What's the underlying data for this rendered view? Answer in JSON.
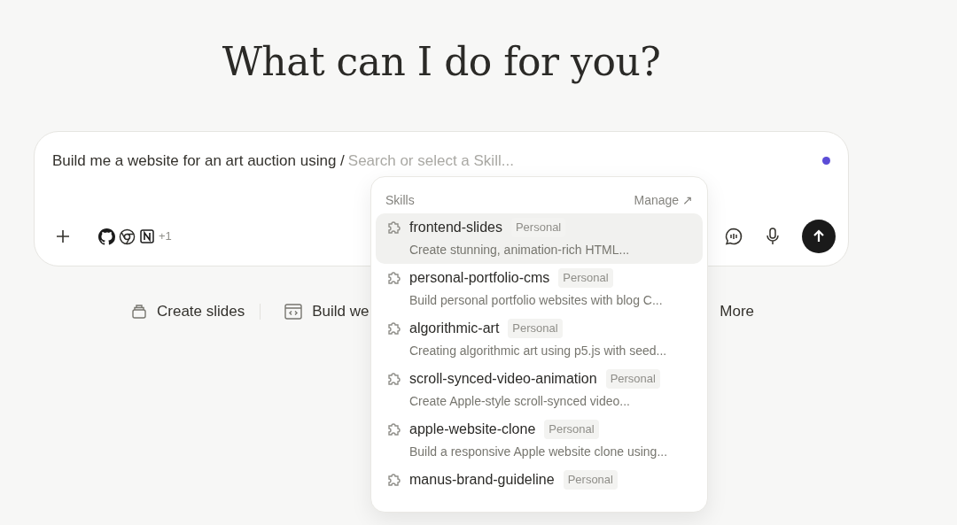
{
  "heading": "What can I do for you?",
  "prompt": {
    "value": "Build me a website for an art auction using /",
    "placeholder": "Search or select a Skill...",
    "connectors_more": "+1"
  },
  "suggestions": [
    {
      "label": "Create slides",
      "kind": "slides"
    },
    {
      "label": "Build we",
      "kind": "web"
    },
    {
      "label": "More",
      "kind": "more"
    }
  ],
  "skills_menu": {
    "title": "Skills",
    "manage": "Manage ↗",
    "items": [
      {
        "name": "frontend-slides",
        "tag": "Personal",
        "description": "Create stunning, animation-rich HTML...",
        "selected": true
      },
      {
        "name": "personal-portfolio-cms",
        "tag": "Personal",
        "description": "Build personal portfolio websites with blog C...",
        "selected": false
      },
      {
        "name": "algorithmic-art",
        "tag": "Personal",
        "description": "Creating algorithmic art using p5.js with seed...",
        "selected": false
      },
      {
        "name": "scroll-synced-video-animation",
        "tag": "Personal",
        "description": "Create Apple-style scroll-synced video...",
        "selected": false
      },
      {
        "name": "apple-website-clone",
        "tag": "Personal",
        "description": "Build a responsive Apple website clone using...",
        "selected": false
      },
      {
        "name": "manus-brand-guideline",
        "tag": "Personal",
        "selected": false
      }
    ]
  }
}
